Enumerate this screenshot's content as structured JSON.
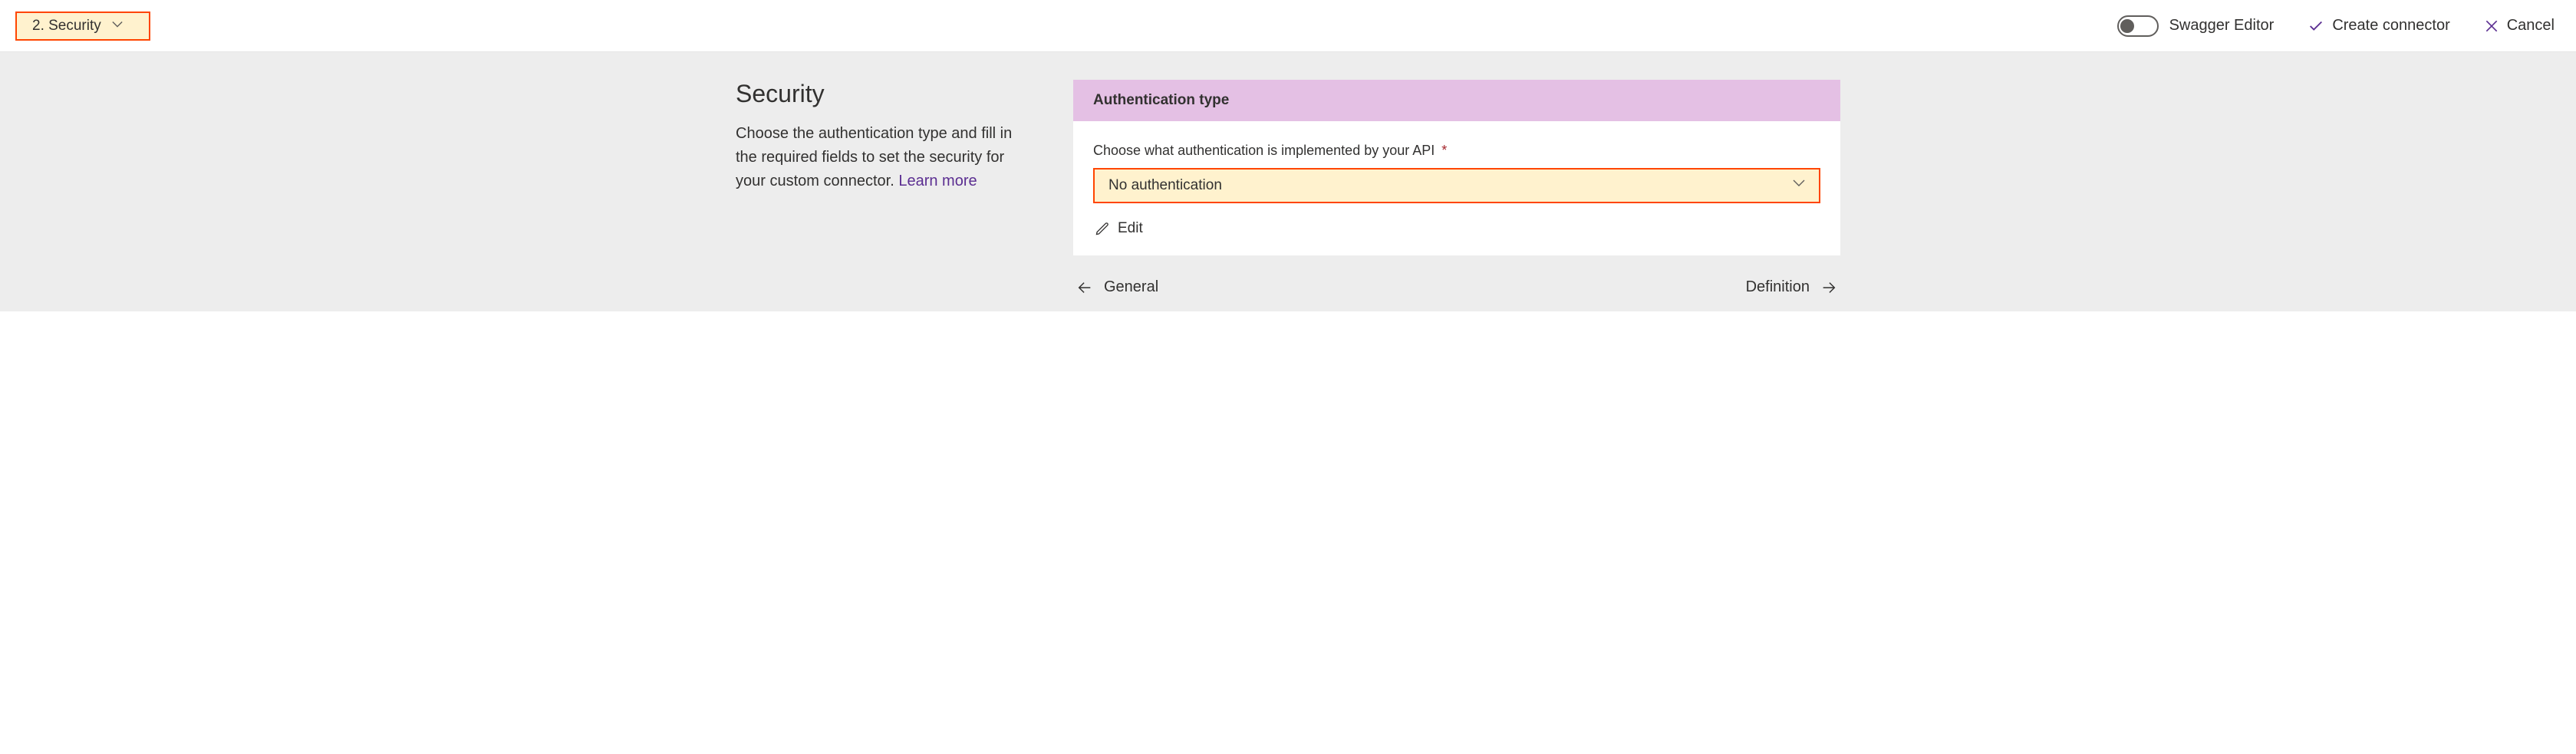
{
  "topbar": {
    "step_label": "2. Security",
    "swagger_label": "Swagger Editor",
    "create_label": "Create connector",
    "cancel_label": "Cancel"
  },
  "left": {
    "heading": "Security",
    "desc_prefix": "Choose the authentication type and fill in the required fields to set the security for your custom connector. ",
    "learn_more": "Learn more"
  },
  "card": {
    "header": "Authentication type",
    "field_label": "Choose what authentication is implemented by your API",
    "required_mark": "*",
    "select_value": "No authentication",
    "edit_label": "Edit"
  },
  "nav": {
    "prev_label": "General",
    "next_label": "Definition"
  }
}
